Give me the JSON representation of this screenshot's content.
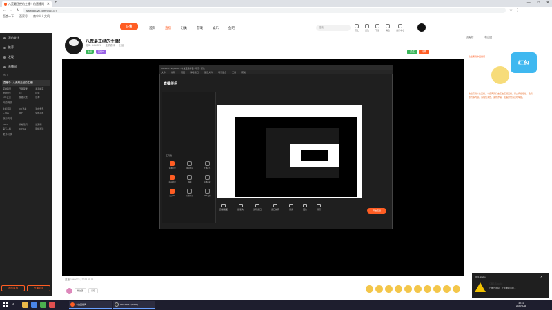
{
  "browser": {
    "tab_title": "八荒最正经的主播！的直播间",
    "new_tab": "+",
    "url": "www.douyu.com/5464374",
    "bookmarks": [
      "百度一下",
      "百家号",
      "南宁人人文机"
    ],
    "controls": [
      "—",
      "□",
      "✕"
    ]
  },
  "site": {
    "logo": "斗鱼",
    "nav": [
      "首页",
      "直播",
      "分类",
      "游戏",
      "娱乐",
      "鱼吧"
    ],
    "search_placeholder": "搜索",
    "header_icons": [
      "历史",
      "关注",
      "下载",
      "消息",
      "创作中心"
    ]
  },
  "sidebar": {
    "main": [
      "我的关注",
      "推荐",
      "发现",
      "直播间"
    ],
    "hot_title": "热门",
    "highlight": [
      "直播中",
      "八荒最正经的主播！"
    ],
    "cells": [
      "英雄联盟",
      "王者荣耀",
      "和平精英",
      "绝地求生",
      "CF",
      "DNF",
      "LOL云顶",
      "穿越火线",
      "原神",
      "主机游戏",
      "QQ飞车",
      "我的世界",
      "三国杀",
      "炉石",
      "使命召唤",
      "APEX",
      "永劫无间",
      "逃跑吧",
      "第五人格",
      "DOTA2",
      "网络游戏"
    ],
    "section_game": "网游竞技",
    "section_ent": "娱乐天地",
    "section_more": "更多分类",
    "btn_left": "我的直播",
    "btn_right": "开播助手"
  },
  "stream": {
    "title": "八荒最正经的主播！",
    "meta": [
      "房间: 5464374",
      "主机游戏",
      "分区"
    ],
    "tags": [
      "主播",
      "直播中"
    ],
    "follow": "关注",
    "share": "分享",
    "status": "直播 1960074 | 2022.11.11"
  },
  "obs": {
    "title": "OBS 28.1.2 (64-bit) - 斗鱼直播伴侣 - 场景: 默认",
    "menu": [
      "文件",
      "编辑",
      "视图",
      "停靠窗口",
      "配置文件",
      "场景集合",
      "工具",
      "帮助"
    ],
    "logo": "直播伴侣",
    "tools_label": "工具箱",
    "grid": [
      "直播设置",
      "推流地址",
      "主播任务",
      "粉丝管理",
      "弹幕",
      "直播数据",
      "连麦PK",
      "礼物特效",
      "OBS设置"
    ],
    "bottom": [
      "直播画面",
      "摄像头",
      "游戏窗口",
      "窗口捕获",
      "音频",
      "图片",
      "场景"
    ],
    "start": "开始直播"
  },
  "right_panel": {
    "tabs": [
      "贡献榜",
      "粉丝团"
    ],
    "line": "欢迎来到本直播间",
    "badge": "红包",
    "text": "欢迎来到斗鱼直播，斗鱼严厉打击违法违规直播，禁止传播低俗、色情、暴力等内容，请理性消费，谨防诈骗，如遇异常请及时举报。"
  },
  "bottom_bar": {
    "buttons": [
      "粉丝团",
      "背包"
    ]
  },
  "toast": {
    "app": "OBS Studio",
    "heading": "OBS Studio",
    "body": "已断开连接，正在重新连接...",
    "close": "✕"
  },
  "taskbar": {
    "win1": "斗鱼直播间",
    "win2": "OBS 28.1.2 (64-bit)",
    "time": "20:41",
    "date": "2022/11/11"
  }
}
